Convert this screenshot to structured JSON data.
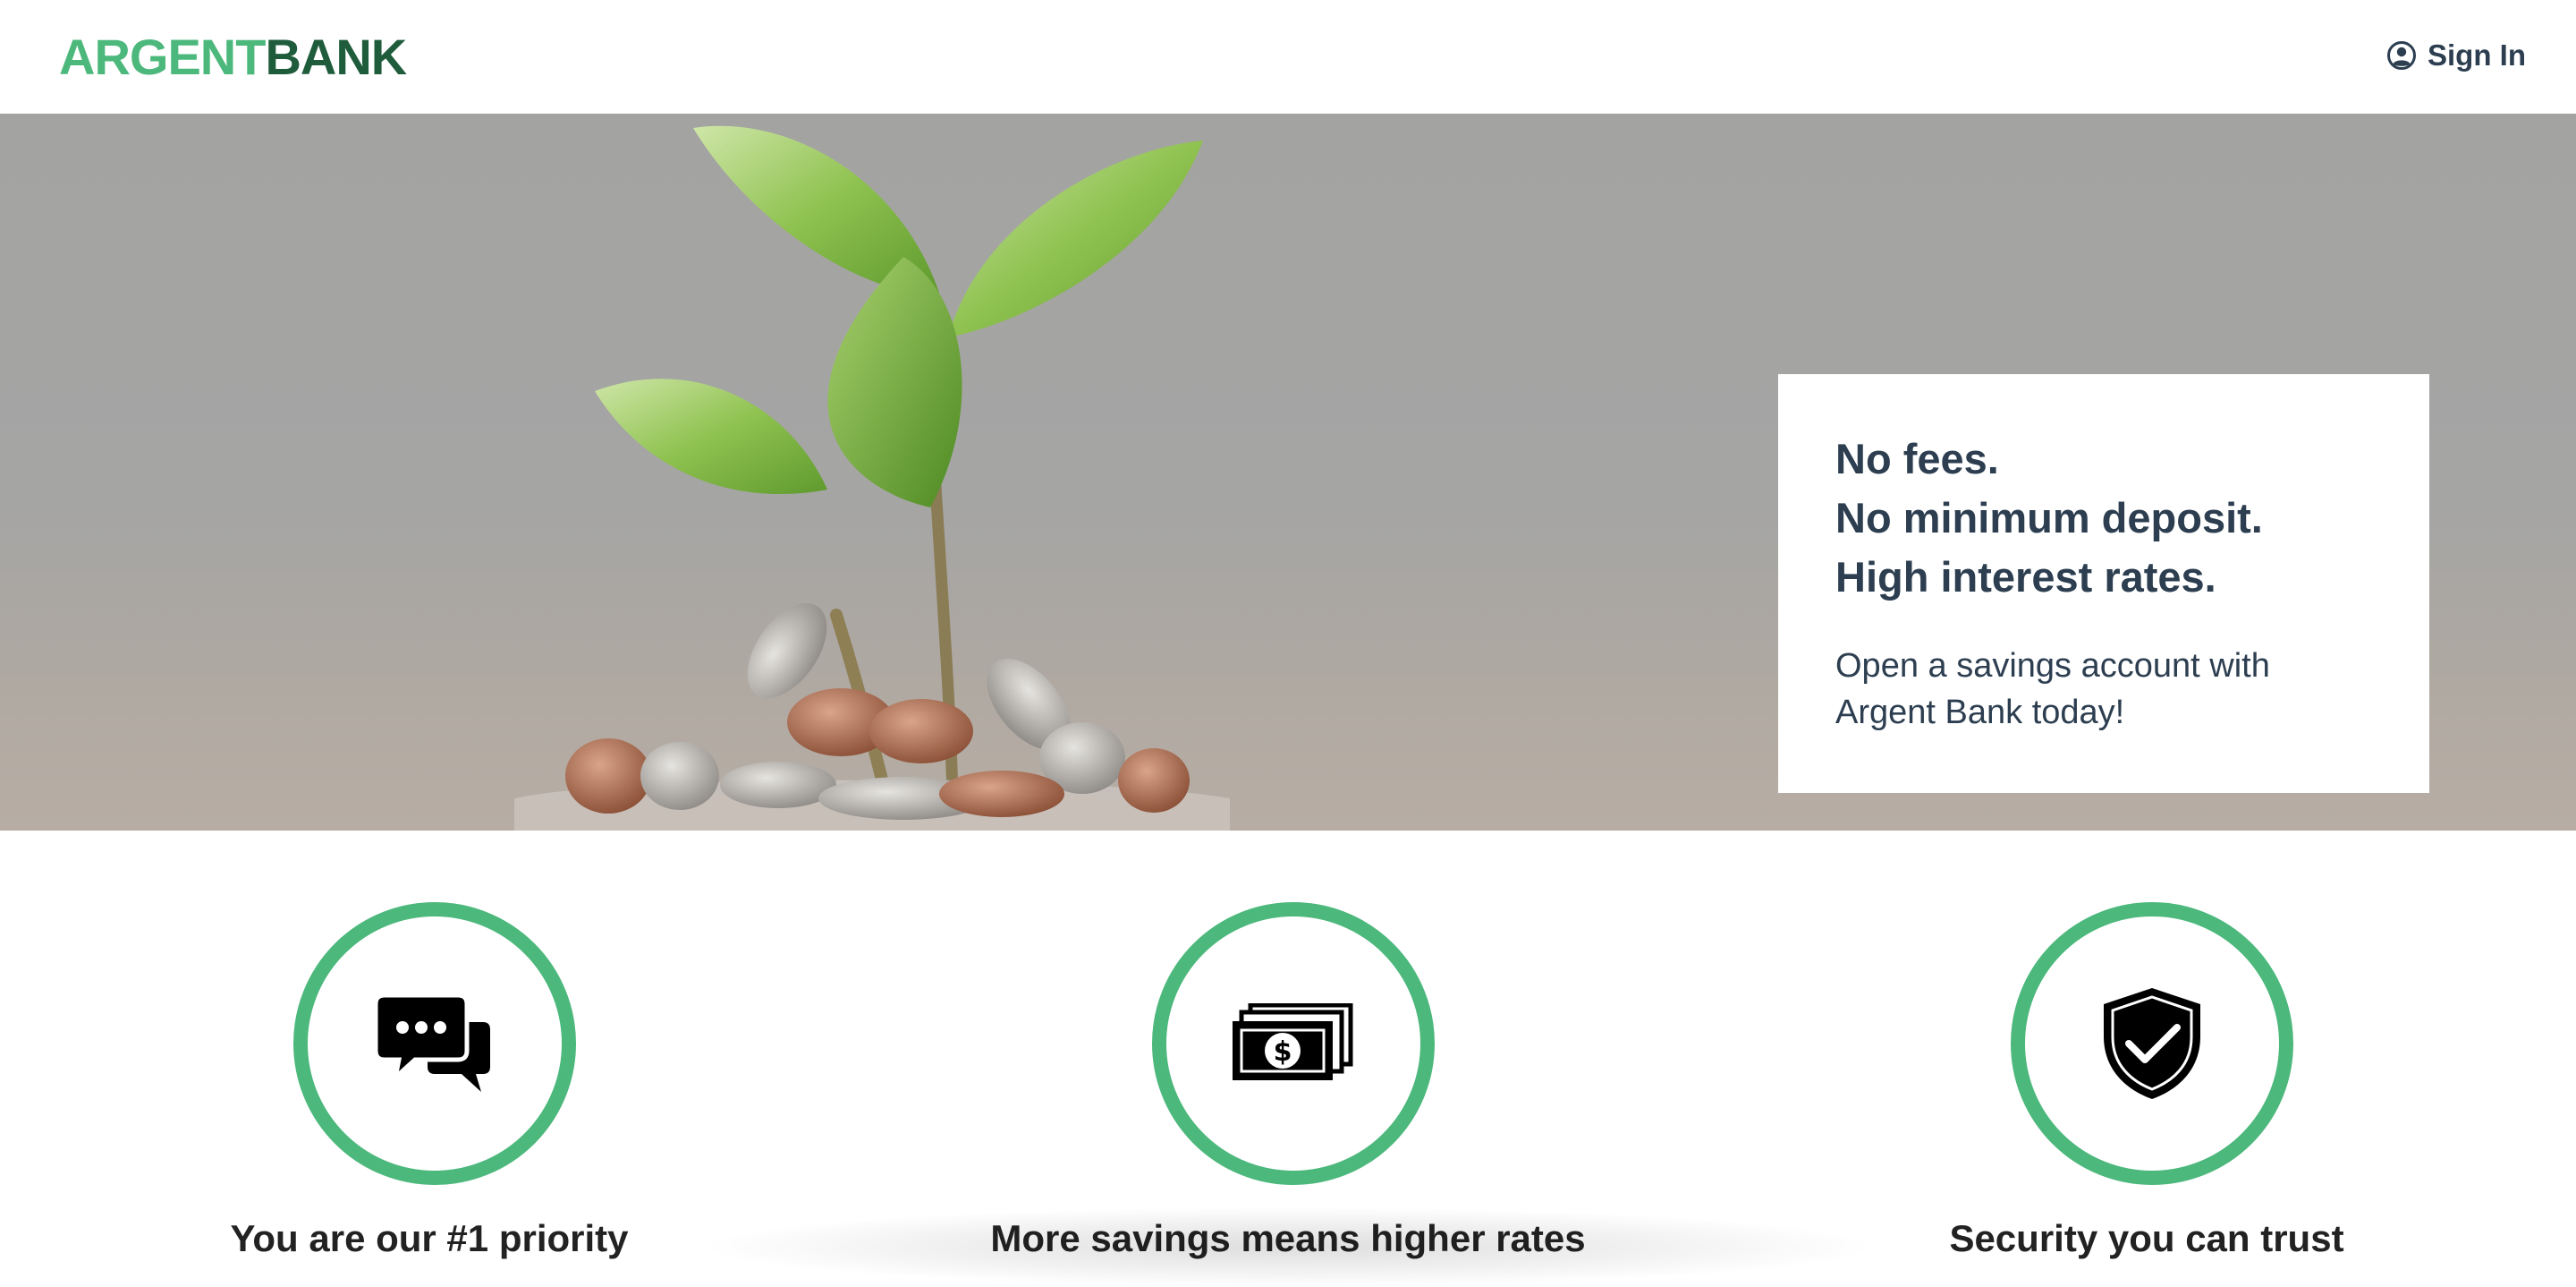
{
  "header": {
    "logo_part1": "ARGENT",
    "logo_part2": "BANK",
    "signin_label": "Sign In"
  },
  "hero": {
    "subtitle_lines": [
      "No fees.",
      "No minimum deposit.",
      "High interest rates."
    ],
    "text_lines": [
      "Open a savings account with",
      "Argent Bank today!"
    ]
  },
  "features": [
    {
      "icon": "chat-icon",
      "title": "You are our #1 priority"
    },
    {
      "icon": "money-icon",
      "title": "More savings means higher rates"
    },
    {
      "icon": "security-icon",
      "title": "Security you can trust"
    }
  ],
  "colors": {
    "brand_green": "#4cb87c",
    "brand_dark_green": "#1f5c3c",
    "text": "#2c3e50"
  }
}
